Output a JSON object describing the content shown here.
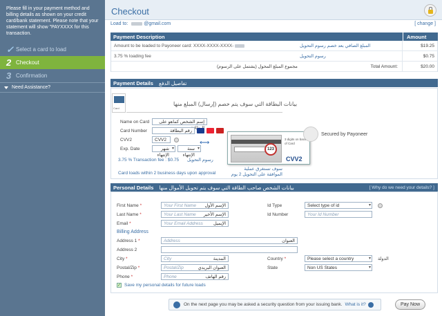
{
  "sidebar": {
    "note": "Please fill in your payment method and billing details as shown on your credit card/bank statement. Please note that your statement will show \"PAYXXXX for this transaction.",
    "steps": [
      {
        "num": "",
        "label": "Select a card to load"
      },
      {
        "num": "2",
        "label": "Checkout"
      },
      {
        "num": "3",
        "label": "Confirmation"
      }
    ],
    "assist": "Need Assistance?"
  },
  "header": {
    "title": "Checkout"
  },
  "load": {
    "label": "Load to:",
    "email_suffix": "@gmail.com",
    "change": "[ change ]"
  },
  "payment": {
    "desc_head": "Payment Description",
    "amount_head": "Amount",
    "rows": [
      {
        "desc": "Amount to be loaded to Payoneer card: XXXX-XXXX-XXXX-",
        "ar": "المبلغ الصافي بعد خصم رسوم التحويل",
        "amount": "$19.25"
      },
      {
        "desc": "3.75 % loading fee",
        "ar": "رسوم التحويل",
        "amount": "$0.75"
      }
    ],
    "total_ar": "مجموع المبلغ المحول (يشتمل على الرسوم)",
    "total_label": "Total Amount:",
    "total_amount": "$20.00"
  },
  "details": {
    "head": "Payment Details",
    "head_ar": "تفاصيل الدفع",
    "card_tab": "Credit Card",
    "card_tab_small": "Card",
    "card_title": "بيانات البطاقة التي سوف يتم خصم (إرسال) المبلغ منها",
    "name_label": "Name on Card",
    "name_value": "إسم الشخص كماهو على البطاقة",
    "number_label": "Card Number",
    "number_value": "رقم البطاقة",
    "cvv_label": "CVV2",
    "cvv_value": "CVV2",
    "exp_label": "Exp. Date",
    "month_value": "شهر الإنتهاء",
    "year_value": "سنة الإنتهاء",
    "cvv_popup_circle": "123",
    "cvv_popup_text": "3 digits on back of Card",
    "cvv_popup_big": "CVV2",
    "secured": "Secured by Payoneer",
    "fee": "3.75 % Transaction fee : $0.75",
    "fee_ar": "رسوم التحويل",
    "loads": "Card loads within 2 business days upon approval",
    "loads_ar_1": "سوف تستغرق عملية",
    "loads_ar_2": "الموافقة على التحويل 2 يوم"
  },
  "personal": {
    "head": "Personal Details",
    "head_ar": "بيانات الشخص صاحب الطاقة التي سوف يتم تحويل الأموال منها",
    "why": "[ Why do we need your details? ]",
    "first_label": "First Name",
    "first_ph": "Your First Name",
    "first_ar": "الإسم الأول",
    "last_label": "Last Name",
    "last_ph": "Your Last Name",
    "last_ar": "الإسم الأخير",
    "email_label": "Email",
    "email_ph": "Your Email Address",
    "email_ar": "الإيميل",
    "id_type_label": "Id Type",
    "id_type_value": "Select type of id",
    "id_number_label": "Id Number",
    "id_number_ph": "Your Id Number",
    "billing": "Billing Address",
    "address1_label": "Address 1",
    "address1_ph": "Address",
    "address1_ar": "العنوان",
    "address2_label": "Address 2",
    "city_label": "City",
    "city_ph": "City",
    "city_ar": "المدينة",
    "country_label": "Country",
    "country_value": "Please select a country",
    "country_ar": "الدولة",
    "postal_label": "Postal/Zip",
    "postal_ph": "Postal/Zip",
    "postal_ar": "العنوان البريدي",
    "state_label": "State",
    "state_value": "Non US States",
    "phone_label": "Phone",
    "phone_ph": "Phone",
    "phone_ar": "رقم الهاتف",
    "save_label": "Save my personal details for future loads",
    "required_mark": "*"
  },
  "footer": {
    "notice": "On the next page you may be asked a security question from your issuing bank.",
    "what_link": "What is it?",
    "pay_button": "Pay Now"
  },
  "colors": {
    "sidebar": "#5a7590",
    "active_step": "#7fb43e",
    "section_head": "#41698f",
    "link": "#3a6ea5"
  }
}
